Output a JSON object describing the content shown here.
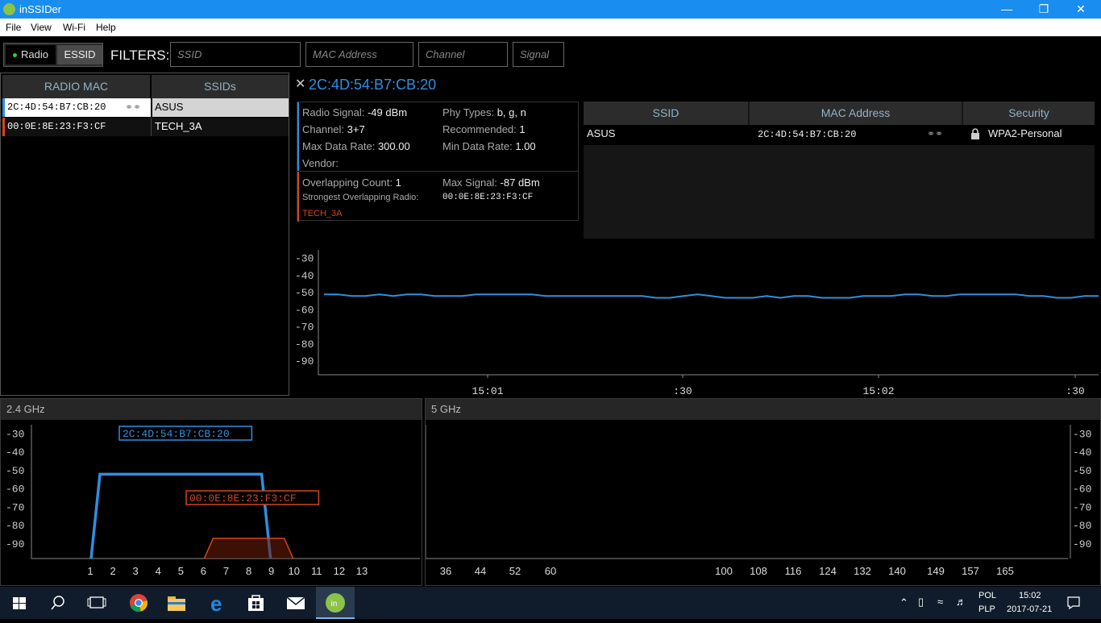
{
  "window": {
    "title": "inSSIDer",
    "menu": [
      "File",
      "View",
      "Wi-Fi",
      "Help"
    ]
  },
  "toolbar": {
    "radio_label": "Radio",
    "essid_label": "ESSID",
    "filters_label": "FILTERS:",
    "filters": [
      "SSID",
      "MAC Address",
      "Channel",
      "Signal"
    ]
  },
  "networks": {
    "headers": [
      "RADIO MAC",
      "SSIDs"
    ],
    "rows": [
      {
        "mac": "2C:4D:54:B7:CB:20",
        "ssid": "ASUS",
        "color": "#2f8fe0",
        "selected": true
      },
      {
        "mac": "00:0E:8E:23:F3:CF",
        "ssid": "TECH_3A",
        "color": "#d6451b",
        "selected": false
      }
    ]
  },
  "details": {
    "title": "2C:4D:54:B7:CB:20",
    "radio_signal_label": "Radio Signal:",
    "radio_signal": "-49 dBm",
    "phy_types_label": "Phy Types:",
    "phy_types": "b, g, n",
    "channel_label": "Channel:",
    "channel": "3+7",
    "recommended_label": "Recommended:",
    "recommended": "1",
    "max_rate_label": "Max Data Rate:",
    "max_rate": "300.00",
    "min_rate_label": "Min Data Rate:",
    "min_rate": "1.00",
    "vendor_label": "Vendor:",
    "overlap_count_label": "Overlapping Count:",
    "overlap_count": "1",
    "max_signal_label": "Max Signal:",
    "max_signal": "-87 dBm",
    "strongest_label": "Strongest Overlapping Radio:",
    "strongest_mac": "00:0E:8E:23:F3:CF",
    "strongest_ssid": "TECH_3A"
  },
  "ssid_table": {
    "headers": [
      "SSID",
      "MAC Address",
      "Security"
    ],
    "rows": [
      {
        "ssid": "ASUS",
        "mac": "2C:4D:54:B7:CB:20",
        "security": "WPA2-Personal"
      }
    ]
  },
  "chart_data": [
    {
      "type": "line",
      "title": "",
      "y_ticks": [
        "-30",
        "-40",
        "-50",
        "-60",
        "-70",
        "-80",
        "-90"
      ],
      "ylim": [
        -98,
        -25
      ],
      "x_ticks": [
        "15:01",
        ":30",
        "15:02",
        ":30"
      ],
      "series": [
        {
          "color": "#2f8fe0",
          "values": [
            -51,
            -51,
            -52,
            -52,
            -51,
            -52,
            -51,
            -51,
            -52,
            -52,
            -52,
            -51,
            -51,
            -51,
            -51,
            -51,
            -52,
            -52,
            -52,
            -52,
            -52,
            -52,
            -52,
            -52,
            -53,
            -53,
            -52,
            -51,
            -52,
            -53,
            -53,
            -53,
            -52,
            -53,
            -52,
            -52,
            -53,
            -53,
            -53,
            -52,
            -52,
            -52,
            -51,
            -51,
            -52,
            -52,
            -51,
            -51,
            -51,
            -51,
            -51,
            -52,
            -52,
            -53,
            -53,
            -52,
            -52
          ]
        }
      ]
    },
    {
      "type": "area",
      "title": "2.4 GHz",
      "y_ticks": [
        "-30",
        "-40",
        "-50",
        "-60",
        "-70",
        "-80",
        "-90"
      ],
      "x_ticks": [
        "1",
        "2",
        "3",
        "4",
        "5",
        "6",
        "7",
        "8",
        "9",
        "10",
        "11",
        "12",
        "13"
      ],
      "ylim": [
        -98,
        -25
      ],
      "series": [
        {
          "label": "2C:4D:54:B7:CB:20",
          "color": "#2f8fe0",
          "channel_start": 1,
          "channel_end": 9,
          "signal": -52
        },
        {
          "label": "00:0E:8E:23:F3:CF",
          "color": "#d6451b",
          "channel_start": 6,
          "channel_end": 10,
          "signal": -87
        }
      ]
    },
    {
      "type": "area",
      "title": "5 GHz",
      "y_ticks": [
        "-30",
        "-40",
        "-50",
        "-60",
        "-70",
        "-80",
        "-90"
      ],
      "x_ticks": [
        "36",
        "44",
        "52",
        "60",
        "100",
        "108",
        "116",
        "124",
        "132",
        "140",
        "149",
        "157",
        "165"
      ],
      "ylim": [
        -98,
        -25
      ],
      "series": []
    }
  ],
  "taskbar": {
    "lang1": "POL",
    "lang2": "PLP",
    "time": "15:02",
    "date": "2017-07-21"
  }
}
